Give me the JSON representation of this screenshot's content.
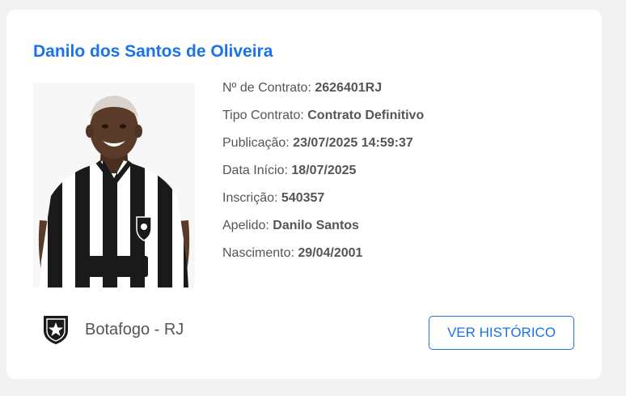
{
  "player": {
    "name": "Danilo dos Santos de Oliveira",
    "photo_alt": "player-photo"
  },
  "details": [
    {
      "label": "Nº de Contrato: ",
      "value": "2626401RJ"
    },
    {
      "label": "Tipo Contrato: ",
      "value": "Contrato Definitivo"
    },
    {
      "label": "Publicação: ",
      "value": "23/07/2025 14:59:37"
    },
    {
      "label": "Data Início: ",
      "value": "18/07/2025"
    },
    {
      "label": "Inscrição: ",
      "value": "540357"
    },
    {
      "label": "Apelido: ",
      "value": "Danilo Santos"
    },
    {
      "label": "Nascimento: ",
      "value": "29/04/2001"
    }
  ],
  "club": {
    "name": "Botafogo - RJ",
    "crest_icon": "botafogo-crest-icon"
  },
  "actions": {
    "history_label": "VER HISTÓRICO"
  },
  "colors": {
    "accent": "#1a73e8",
    "text": "#555555",
    "background": "#f2f2f2",
    "card": "#ffffff"
  }
}
